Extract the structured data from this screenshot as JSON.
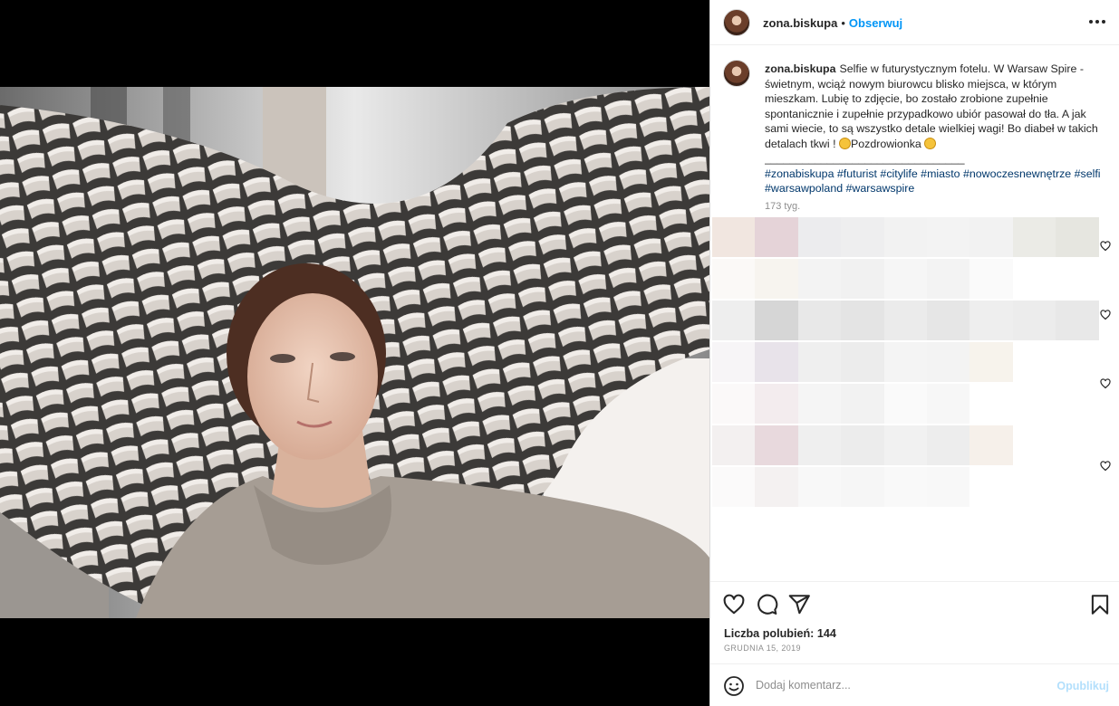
{
  "post": {
    "username": "zona.biskupa",
    "separator": "•",
    "follow_label": "Obserwuj",
    "caption": {
      "username": "zona.biskupa",
      "text_before_emoji": "Selfie w futurystycznym fotelu. W Warsaw Spire - świetnym, wciąż nowym biurowcu blisko miejsca, w którym mieszkam. Lubię to zdjęcie, bo zostało zrobione zupełnie spontanicznie i zupełnie przypadkowo ubiór pasował do tła. A jak sami wiecie, to są wszystko detale wielkiej wagi! Bo diabeł w takich detalach tkwi ! ",
      "text_after_emoji": "Pozdrowionka ",
      "divider": "________________________________",
      "hashtags": "#zonabiskupa #futurist #citylife #miasto #nowoczesnewnętrze #selfi #warsawpoland #warsawspire"
    },
    "time_ago": "173 tyg.",
    "likes_text": "Liczba polubień: 144",
    "date": "GRUDNIA 15, 2019",
    "comment_placeholder": "Dodaj komentarz...",
    "publish_label": "Opublikuj"
  },
  "icons": {
    "more": "more-horizontal-icon",
    "like": "heart-icon",
    "comment": "comment-icon",
    "share": "send-icon",
    "save": "bookmark-icon",
    "emoji": "emoji-icon"
  },
  "colors": {
    "accent": "#0095f6",
    "hashtag": "#00376b",
    "muted": "#8e8e8e",
    "publish_disabled": "#b2dffc"
  }
}
